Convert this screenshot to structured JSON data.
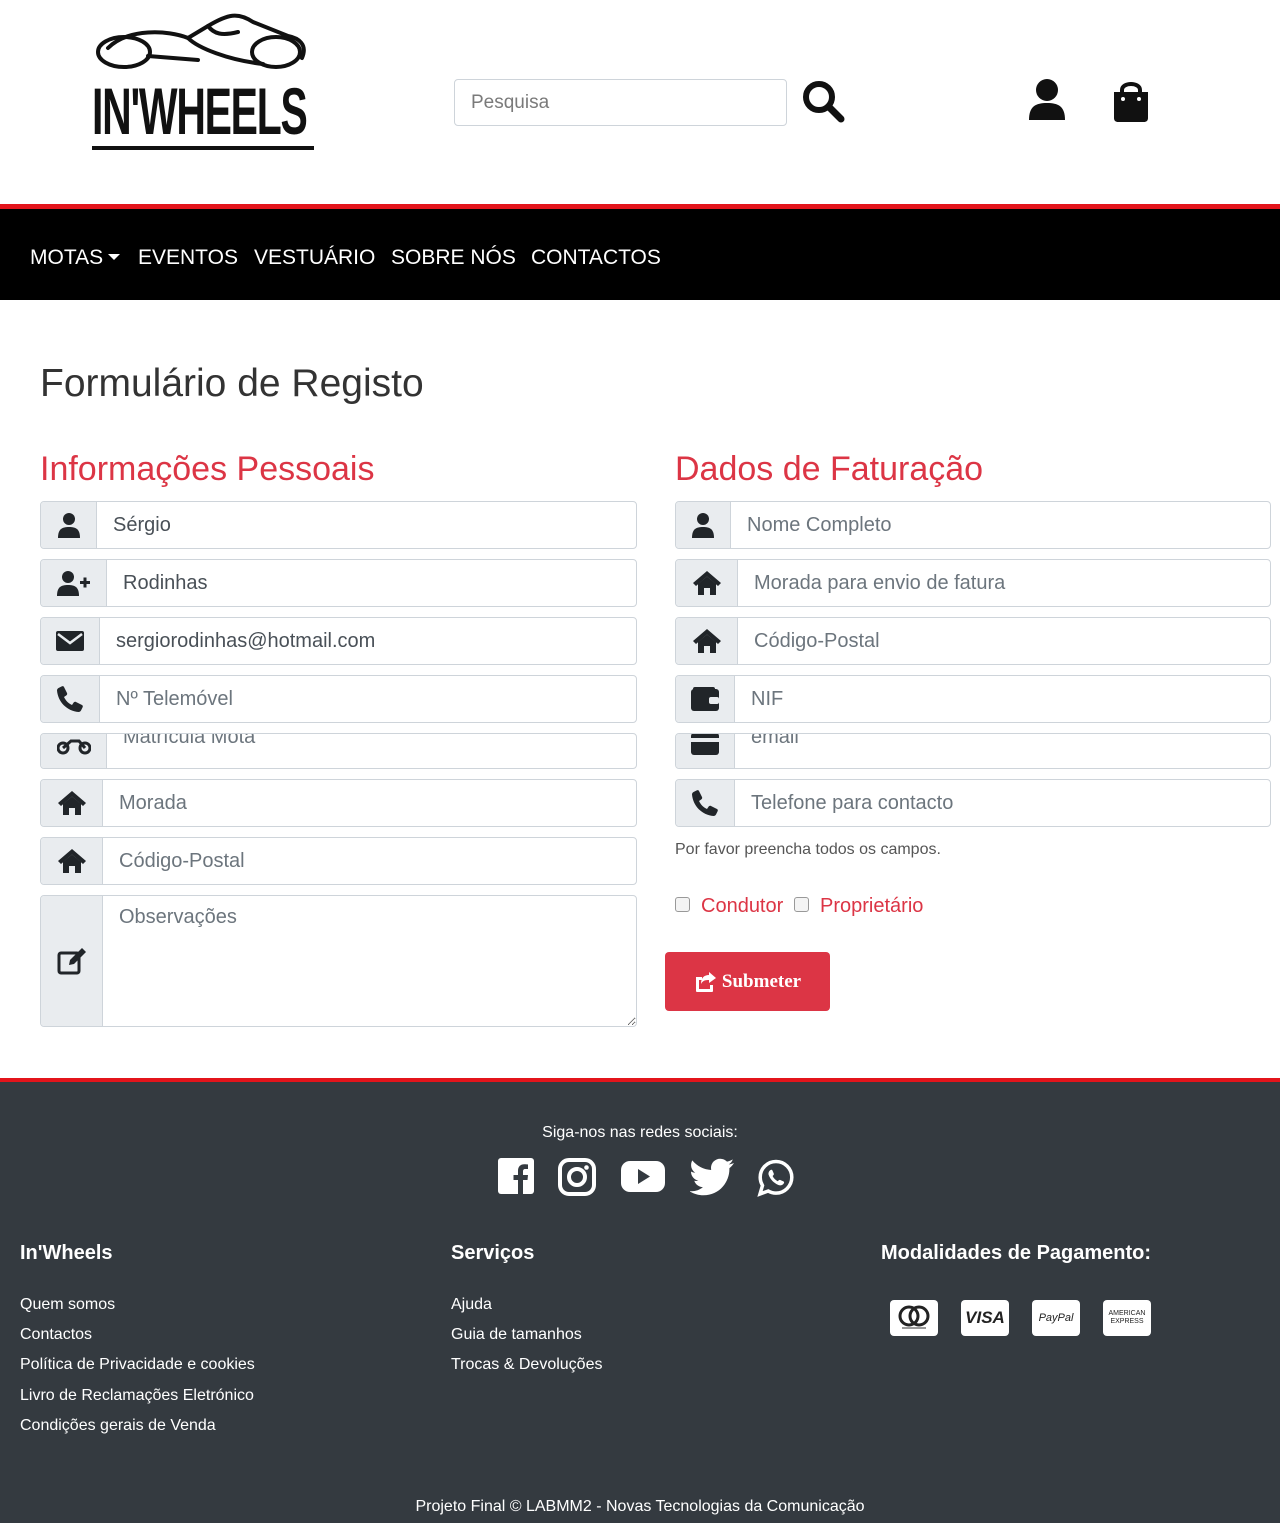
{
  "brand": {
    "logo_text": "IN'WHEELS"
  },
  "search": {
    "placeholder": "Pesquisa"
  },
  "nav": {
    "items": [
      "MOTAS",
      "EVENTOS",
      "VESTUÁRIO",
      "SOBRE NÓS",
      "CONTACTOS"
    ]
  },
  "page": {
    "title": "Formulário de Registo"
  },
  "personal": {
    "title": "Informações Pessoais",
    "first_name": {
      "value": "Sérgio",
      "icon": "user-icon"
    },
    "last_name": {
      "value": "Rodinhas",
      "icon": "user-plus-icon"
    },
    "email": {
      "value": "sergiorodinhas@hotmail.com",
      "icon": "envelope-icon"
    },
    "phone": {
      "placeholder": "Nº Telemóvel",
      "icon": "phone-icon"
    },
    "plate": {
      "placeholder": "Matrícula Mota",
      "icon": "motorcycle-icon"
    },
    "address": {
      "placeholder": "Morada",
      "icon": "home-icon"
    },
    "postal": {
      "placeholder": "Código-Postal",
      "icon": "home-icon"
    },
    "notes": {
      "placeholder": "Observações",
      "icon": "edit-icon"
    }
  },
  "billing": {
    "title": "Dados de Faturação",
    "full_name": {
      "placeholder": "Nome Completo",
      "icon": "user-icon"
    },
    "billing_address": {
      "placeholder": "Morada para envio de fatura",
      "icon": "home-icon"
    },
    "postal": {
      "placeholder": "Código-Postal",
      "icon": "home-icon"
    },
    "nif": {
      "placeholder": "NIF",
      "icon": "wallet-icon"
    },
    "email": {
      "placeholder": "email",
      "icon": "card-icon"
    },
    "phone": {
      "placeholder": "Telefone para contacto",
      "icon": "phone-icon"
    },
    "help": "Por favor preencha todos os campos.",
    "checkbox_driver": "Condutor",
    "checkbox_owner": "Proprietário",
    "submit": "Submeter"
  },
  "footer": {
    "follow": "Siga-nos nas redes sociais:",
    "social": [
      "facebook-icon",
      "instagram-icon",
      "youtube-icon",
      "twitter-icon",
      "whatsapp-icon"
    ],
    "col1": {
      "title": "In'Wheels",
      "links": [
        "Quem somos",
        "Contactos",
        "Política de Privacidade e cookies",
        "Livro de Reclamações Eletrónico",
        "Condições gerais de Venda"
      ]
    },
    "col2": {
      "title": "Serviços",
      "links": [
        "Ajuda",
        "Guia de tamanhos",
        "Trocas & Devoluções"
      ]
    },
    "col3": {
      "title": "Modalidades de Pagamento:",
      "methods": [
        "mastercard",
        "VISA",
        "PayPal",
        "AMERICAN EXPRESS"
      ]
    },
    "copyright": "Projeto Final © LABMM2 - Novas Tecnologias da Comunicação"
  },
  "colors": {
    "accent": "#dc3545",
    "nav_bg": "#000000",
    "nav_border": "#e3141b",
    "footer_bg": "#343a40"
  }
}
